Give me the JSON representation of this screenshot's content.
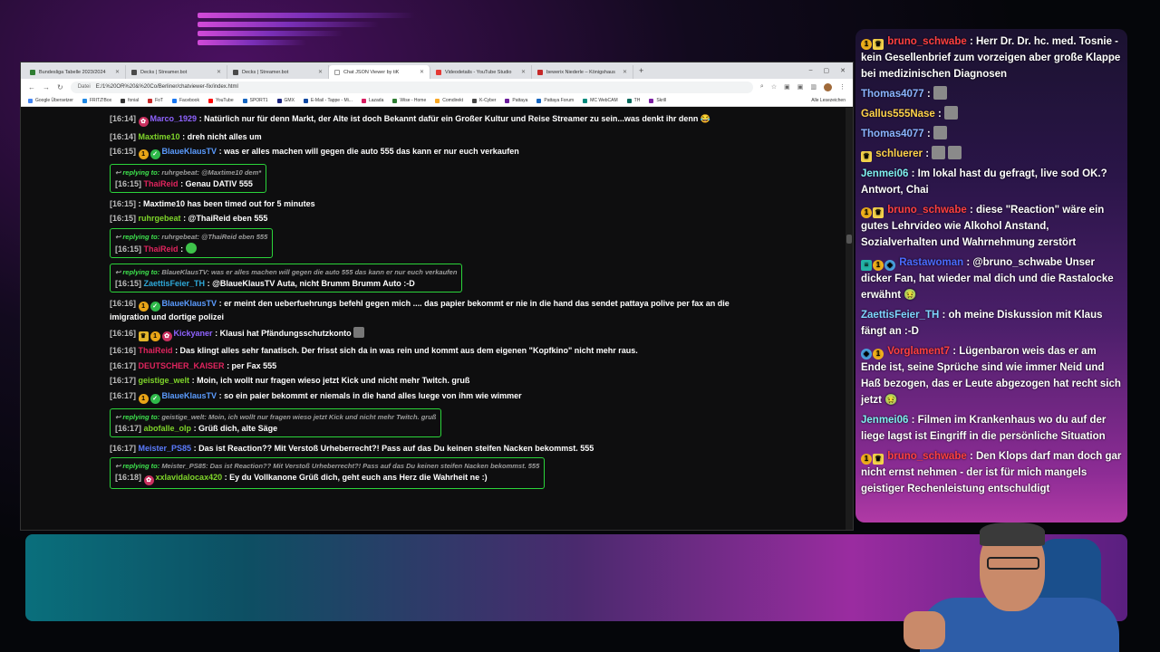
{
  "browser": {
    "tabs": [
      {
        "title": "Bundesliga Tabelle 2023/2024",
        "color": "#2f7d32"
      },
      {
        "title": "Decks | Streamer.bot",
        "color": "#4a4a4a"
      },
      {
        "title": "Decks | Streamer.bot",
        "color": "#4a4a4a"
      },
      {
        "title": "Chat JSON Viewer by tiK",
        "color": "#ffffff",
        "active": true
      },
      {
        "title": "Videodetails - YouTube Studio",
        "color": "#e53935"
      },
      {
        "title": "bewerix Niederle – Königshaus",
        "color": "#c62828"
      }
    ],
    "new_tab": "+",
    "window_controls": [
      "–",
      "▢",
      "✕"
    ],
    "url_label": "Datei",
    "url": "E:/1%20OR%20&%20Co/Berliner/chatviewer-fix/index.html",
    "bookmarks": [
      "Google Übersetzer",
      "FRITZ!Box",
      "fonial",
      "FoT",
      "Facebook",
      "YouTube",
      "SPORT1",
      "GMX",
      "E-Mail - Tappe - Mi...",
      "Lazada",
      "Wise - Home",
      "Comdirekt",
      "K-Cyber",
      "Pattaya",
      "Pattaya Forum",
      "MC WebCAM",
      "TH",
      "Skrill"
    ],
    "bookmarks_right": "Alle Lesezeichen"
  },
  "chat": [
    {
      "ts": "[16:14]",
      "badges": [
        "pink"
      ],
      "user": "Marco_1929",
      "ucolor": "#8f63ff",
      "text": ": Natürlich nur für denn Markt, der Alte ist doch Bekannt dafür ein Großer Kultur und Reise Streamer zu sein...was denkt ihr denn 😂"
    },
    {
      "ts": "[16:14]",
      "badges": [],
      "user": "Maxtime10",
      "ucolor": "#7fd62a",
      "text": ": dreh nicht alles um"
    },
    {
      "ts": "[16:15]",
      "badges": [
        "gold",
        "green"
      ],
      "user": "BlaueKlausTV",
      "ucolor": "#5b9cff",
      "text": ": was er alles machen will gegen die auto 555 das kann er nur euch verkaufen"
    },
    {
      "reply": true,
      "reply_label": "replying to:",
      "reply_text": "ruhrgebeat: @Maxtime10 dem*",
      "ts": "[16:15]",
      "badges": [],
      "user": "ThaiReid",
      "ucolor": "#e0245e",
      "text": ": Genau DATIV 555"
    },
    {
      "ts": "[16:15]",
      "badges": [],
      "user": "",
      "ucolor": "#ffffff",
      "text": ": Maxtime10 has been timed out for 5 minutes"
    },
    {
      "ts": "[16:15]",
      "badges": [],
      "user": "ruhrgebeat",
      "ucolor": "#7fd62a",
      "text": ": @ThaiReid eben 555"
    },
    {
      "reply": true,
      "reply_label": "replying to:",
      "reply_text": "ruhrgebeat: @ThaiReid eben 555",
      "ts": "[16:15]",
      "badges": [],
      "user": "ThaiReid",
      "ucolor": "#e0245e",
      "text": ":"
    },
    {
      "reply": true,
      "reply_label": "replying to:",
      "reply_text": "BlaueKlausTV: was er alles machen will gegen die auto 555 das kann er nur euch verkaufen",
      "ts": "[16:15]",
      "badges": [],
      "user": "ZaettisFeier_TH",
      "ucolor": "#2ea8d8",
      "text": ": @BlaueKlausTV Auta, nicht Brumm Brumm Auto :-D"
    },
    {
      "ts": "[16:16]",
      "badges": [
        "gold",
        "green"
      ],
      "user": "BlaueKlausTV",
      "ucolor": "#5b9cff",
      "text": ": er meint den ueberfuehrungs befehl gegen mich .... das papier bekommt er nie in die hand das sendet pattaya polive per fax an die imigration und dortige polizei"
    },
    {
      "ts": "[16:16]",
      "badges": [
        "crown",
        "gold",
        "pink"
      ],
      "user": "Kickyaner",
      "ucolor": "#8f63ff",
      "text": ": Klausi hat Pfändungsschutzkonto"
    },
    {
      "ts": "[16:16]",
      "badges": [],
      "user": "ThaiReid",
      "ucolor": "#e0245e",
      "text": ": Das klingt alles sehr fanatisch. Der frisst sich da in was rein und kommt aus dem eigenen \"Kopfkino\" nicht mehr raus."
    },
    {
      "ts": "[16:17]",
      "badges": [],
      "user": "DEUTSCHER_KAISER",
      "ucolor": "#e0245e",
      "text": ": per Fax 555"
    },
    {
      "ts": "[16:17]",
      "badges": [],
      "user": "geistige_welt",
      "ucolor": "#7fd62a",
      "text": ": Moin, ich wollt nur fragen wieso jetzt Kick und nicht mehr Twitch. gruß"
    },
    {
      "ts": "[16:17]",
      "badges": [
        "gold",
        "green"
      ],
      "user": "BlaueKlausTV",
      "ucolor": "#5b9cff",
      "text": ": so ein paier bekommt er niemals in die hand alles luege von ihm wie wimmer"
    },
    {
      "reply": true,
      "reply_label": "replying to:",
      "reply_text": "geistige_welt: Moin, ich wollt nur fragen wieso jetzt Kick und nicht mehr Twitch. gruß",
      "ts": "[16:17]",
      "badges": [],
      "user": "abofalle_olp",
      "ucolor": "#7fd62a",
      "text": ": Grüß dich, alte Säge"
    },
    {
      "ts": "[16:17]",
      "badges": [],
      "user": "Meister_PS85",
      "ucolor": "#5b7cff",
      "text": ": Das ist Reaction?? Mit Verstoß Urheberrecht?! Pass auf das Du keinen steifen Nacken bekommst. 555"
    },
    {
      "reply": true,
      "reply_label": "replying to:",
      "reply_text": "Meister_PS85: Das ist Reaction?? Mit Verstoß Urheberrecht?! Pass auf das Du keinen steifen Nacken bekommst. 555",
      "ts": "[16:18]",
      "badges": [
        "pink"
      ],
      "user": "xxlavidalocax420",
      "ucolor": "#7fd62a",
      "text": ": Ey du Vollkanone Grüß dich, geht euch ans Herz die Wahrheit ne :)"
    }
  ],
  "side_chat": [
    {
      "badges": [
        "gold",
        "yellow"
      ],
      "user": "bruno_schwabe",
      "ucolor": "#ff4040",
      "text": ": Herr Dr. Dr. hc. med. Tosnie - kein Gesellenbrief zum vorzeigen aber große Klappe bei medizinischen Diagnosen",
      "emotes": 0
    },
    {
      "badges": [],
      "user": "Thomas4077",
      "ucolor": "#8ab4ff",
      "text": ":",
      "emotes": 1
    },
    {
      "badges": [],
      "user": "Gallus555Nase",
      "ucolor": "#ffd24a",
      "text": ":",
      "emotes": 1
    },
    {
      "badges": [],
      "user": "Thomas4077",
      "ucolor": "#8ab4ff",
      "text": ":",
      "emotes": 1
    },
    {
      "badges": [
        "yellow"
      ],
      "user": "schluerer",
      "ucolor": "#ffd24a",
      "text": ":",
      "emotes": 2
    },
    {
      "badges": [],
      "user": "Jenmei06",
      "ucolor": "#7ff0f0",
      "text": ": Im lokal hast du gefragt, live sod OK.? Antwort, Chai",
      "emotes": 0
    },
    {
      "badges": [
        "gold",
        "yellow"
      ],
      "user": "bruno_schwabe",
      "ucolor": "#ff4040",
      "text": ": diese \"Reaction\" wäre ein gutes Lehrvideo wie Alkohol Anstand, Sozialverhalten und Wahrnehmung zerstört",
      "emotes": 0
    },
    {
      "badges": [
        "teal",
        "gold",
        "blue"
      ],
      "user": "Rastawoman",
      "ucolor": "#4a6bff",
      "text": ": @bruno_schwabe Unser dicker Fan, hat wieder mal dich und die Rastalocke erwähnt 🤢",
      "emotes": 0
    },
    {
      "badges": [],
      "user": "ZaettisFeier_TH",
      "ucolor": "#7fd6ff",
      "text": ": oh meine Diskussion mit Klaus fängt an :-D",
      "emotes": 0
    },
    {
      "badges": [
        "blue",
        "gold"
      ],
      "user": "Vorglament7",
      "ucolor": "#ff4040",
      "text": ": Lügenbaron weis das er am Ende ist, seine Sprüche sind wie immer Neid und Haß bezogen, das er Leute abgezogen hat recht sich jetzt 🤢",
      "emotes": 0
    },
    {
      "badges": [],
      "user": "Jenmei06",
      "ucolor": "#7ff0f0",
      "text": ": Filmen im Krankenhaus wo du auf der liege lagst ist Eingriff in die persönliche Situation",
      "emotes": 0
    },
    {
      "badges": [
        "gold",
        "yellow"
      ],
      "user": "bruno_schwabe",
      "ucolor": "#ff4040",
      "text": ": Den Klops darf man doch gar nicht ernst nehmen - der ist für mich mangels geistiger Rechenleistung entschuldigt",
      "emotes": 0
    }
  ]
}
